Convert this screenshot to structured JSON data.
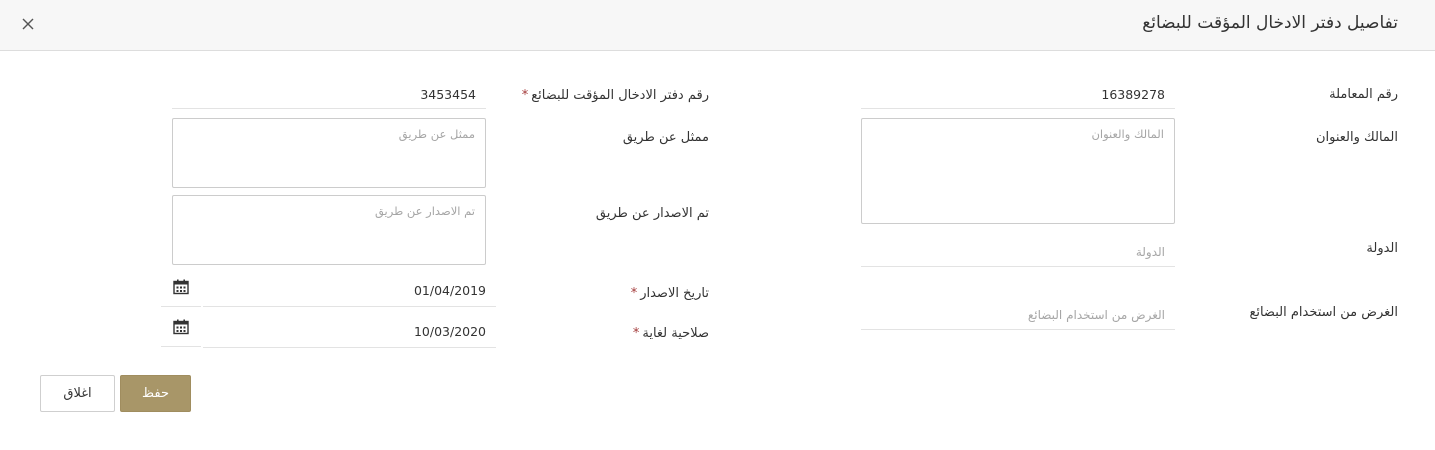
{
  "modal": {
    "title": "تفاصيل دفتر الادخال المؤقت للبضائع",
    "close_icon": "close-icon"
  },
  "right_column": {
    "transaction_number": {
      "label": "رقم المعاملة",
      "value": "16389278"
    },
    "owner_address": {
      "label": "المالك والعنوان",
      "placeholder": "المالك والعنوان"
    },
    "country": {
      "label": "الدولة",
      "placeholder": "الدولة"
    },
    "goods_purpose": {
      "label": "الغرض من استخدام البضائع",
      "placeholder": "الغرض من استخدام البضائع"
    }
  },
  "left_column": {
    "temp_entry_book_number": {
      "label": "رقم دفتر الادخال المؤقت للبضائع",
      "required_mark": "*",
      "value": "3453454"
    },
    "represented_by": {
      "label": "ممثل عن طريق",
      "placeholder": "ممثل عن طريق"
    },
    "issued_by": {
      "label": "تم الاصدار عن طريق",
      "placeholder": "تم الاصدار عن طريق"
    },
    "issue_date": {
      "label": "تاريخ الاصدار",
      "required_mark": "*",
      "value": "01/04/2019",
      "icon": "calendar-icon"
    },
    "valid_until": {
      "label": "صلاحية لغاية",
      "required_mark": "*",
      "value": "10/03/2020",
      "icon": "calendar-icon"
    }
  },
  "footer": {
    "save_label": "حفظ",
    "close_label": "اغلاق"
  },
  "colors": {
    "primary_button": "#a89668",
    "required": "#a33a3a",
    "placeholder": "#a6a6a6",
    "header_bg": "#f7f7f7"
  }
}
